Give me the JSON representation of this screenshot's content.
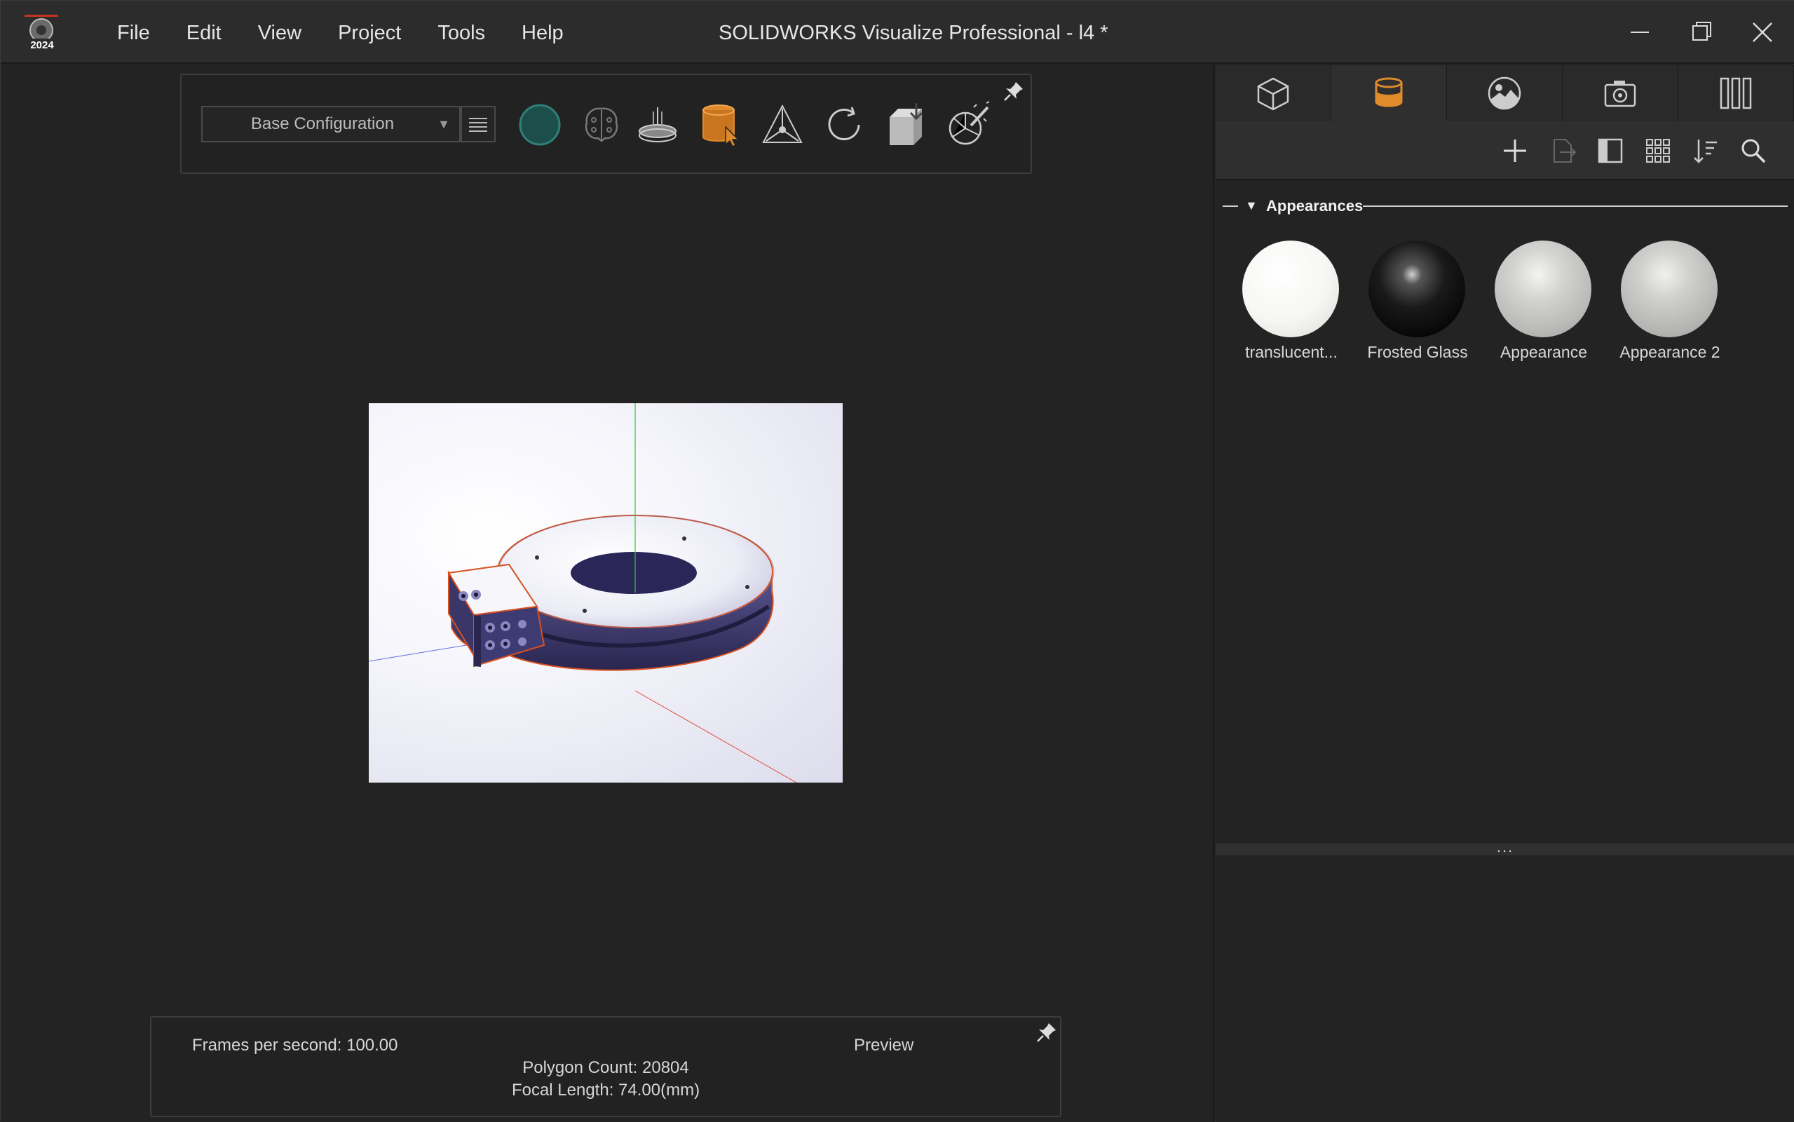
{
  "app": {
    "logo_year": "2024",
    "title": "SOLIDWORKS Visualize Professional - l4 *"
  },
  "menu": [
    "File",
    "Edit",
    "View",
    "Project",
    "Tools",
    "Help"
  ],
  "toolbar": {
    "configuration": "Base Configuration",
    "icons": [
      "render-mode-icon",
      "ai-denoiser-icon",
      "turntable-icon",
      "appearance-picker-icon",
      "object-tool-icon",
      "refresh-icon",
      "import-model-icon",
      "camera-edit-icon"
    ]
  },
  "status": {
    "fps": "Frames per second: 100.00",
    "mode": "Preview",
    "polygon_count": "Polygon Count: 20804",
    "focal_length": "Focal Length: 74.00(mm)"
  },
  "panel": {
    "tabs": [
      "models-tab",
      "appearances-tab",
      "scenes-tab",
      "cameras-tab",
      "libraries-tab"
    ],
    "active_tab": "appearances-tab",
    "section_title": "Appearances",
    "divider_dots": "...",
    "appearances": [
      {
        "label": "translucent...",
        "color": "#f4f4f2"
      },
      {
        "label": "Frosted Glass",
        "color": "#101010"
      },
      {
        "label": "Appearance",
        "color": "#c8c8c6"
      },
      {
        "label": "Appearance 2",
        "color": "#c4c4c2"
      }
    ]
  },
  "colors": {
    "accent": "#e08a2c",
    "teal": "#1c4f4c",
    "model": "#3b3668",
    "selection_outline": "#d8501e"
  }
}
